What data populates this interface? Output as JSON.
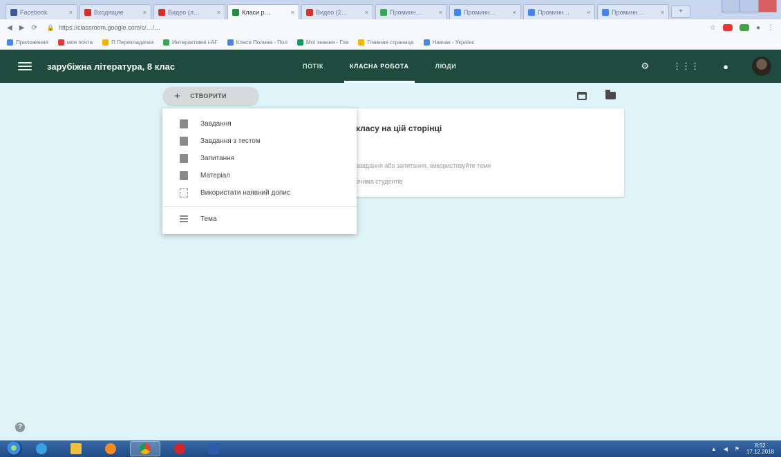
{
  "browser": {
    "tabs": [
      {
        "title": "Facebook",
        "favicon_color": "#3b5998",
        "active": false
      },
      {
        "title": "Входящие",
        "favicon_color": "#d93025",
        "active": false
      },
      {
        "title": "Видео (л…",
        "favicon_color": "#d93025",
        "active": false
      },
      {
        "title": "Класи р…",
        "favicon_color": "#1e8e3e",
        "active": true
      },
      {
        "title": "Видео (2…",
        "favicon_color": "#d93025",
        "active": false
      },
      {
        "title": "Проминн…",
        "favicon_color": "#34a853",
        "active": false
      },
      {
        "title": "Проминн…",
        "favicon_color": "#4285f4",
        "active": false
      },
      {
        "title": "Проминн…",
        "favicon_color": "#4285f4",
        "active": false
      },
      {
        "title": "Проминн…",
        "favicon_color": "#4285f4",
        "active": false
      }
    ],
    "url": "https://classroom.google.com/c/…/…",
    "bookmarks": [
      {
        "label": "Приложения",
        "color": "#4285f4"
      },
      {
        "label": "моя почта",
        "color": "#e53935"
      },
      {
        "label": "П Перекладачки",
        "color": "#f4b400"
      },
      {
        "label": "Интерактивні і-АГ",
        "color": "#34a853"
      },
      {
        "label": "Класи Полина - Пол",
        "color": "#4285f4"
      },
      {
        "label": "Мої знання - Гла",
        "color": "#0f9d58"
      },
      {
        "label": "Главная страница",
        "color": "#f4b400"
      },
      {
        "label": "Навчак - Українс",
        "color": "#4285f4"
      }
    ]
  },
  "header": {
    "title": "зарубіжна література, 8 клас",
    "tabs": [
      "ПОТІК",
      "КЛАСНА РОБОТА",
      "ЛЮДИ"
    ],
    "active_tab_index": 1
  },
  "toolbar": {
    "create_label": "СТВОРИТИ"
  },
  "menu": {
    "items": [
      {
        "label": "Завдання",
        "icon": "assignment-icon"
      },
      {
        "label": "Завдання з тестом",
        "icon": "quiz-assignment-icon"
      },
      {
        "label": "Запитання",
        "icon": "question-icon"
      },
      {
        "label": "Матеріал",
        "icon": "material-icon"
      },
      {
        "label": "Використати наявний допис",
        "icon": "reuse-post-icon"
      }
    ],
    "topic_label": "Тема"
  },
  "card": {
    "title": "класу на цій сторінці",
    "line1": "завдання або запитання, використовуйте теми",
    "line2": "очима студентів"
  },
  "taskbar": {
    "time": "8:52",
    "date": "17.12.2018"
  },
  "colors": {
    "header_bg": "#1e4b3d",
    "page_bg": "#dff4f8",
    "taskbar": "#1f4b84"
  }
}
